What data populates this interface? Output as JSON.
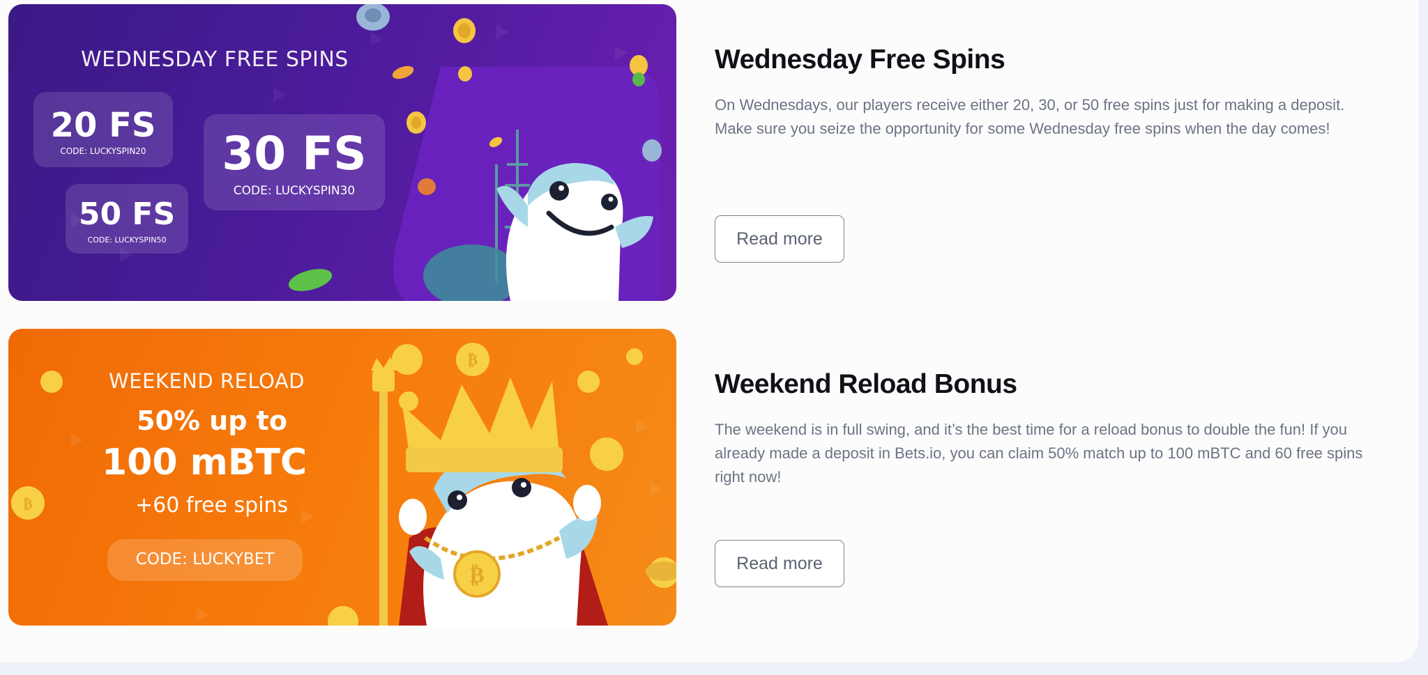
{
  "promos": [
    {
      "banner": {
        "heading": "WEDNESDAY FREE SPINS",
        "offers": [
          {
            "amount": "20 FS",
            "code": "CODE: LUCKYSPIN20"
          },
          {
            "amount": "30 FS",
            "code": "CODE: LUCKYSPIN30"
          },
          {
            "amount": "50 FS",
            "code": "CODE: LUCKYSPIN50"
          }
        ]
      },
      "title": "Wednesday Free Spins",
      "description": "On Wednesdays, our players receive either 20, 30, or 50 free spins just for making a deposit. Make sure you seize the opportunity for some Wednesday free spins when the day comes!",
      "button_label": "Read more"
    },
    {
      "banner": {
        "heading": "WEEKEND RELOAD",
        "line1": "50% up to",
        "line2": "100 mBTC",
        "line3": "+60 free spins",
        "code": "CODE: LUCKYBET"
      },
      "title": "Weekend Reload Bonus",
      "description": "The weekend is in full swing, and it’s the best time for a reload bonus to double the fun! If you already made a deposit in Bets.io, you can claim 50% match up to 100 mBTC and 60 free spins right now!",
      "button_label": "Read more"
    }
  ],
  "colors": {
    "purple_banner": "#4b1b9a",
    "orange_banner": "#f77c0b",
    "title": "#0f1117",
    "body_text": "#6b7383",
    "button_border": "#7b8190"
  },
  "icons": [
    "mascot-illustration",
    "coin-icon",
    "bitcoin-coin-icon",
    "crown-icon",
    "scepter-icon"
  ]
}
